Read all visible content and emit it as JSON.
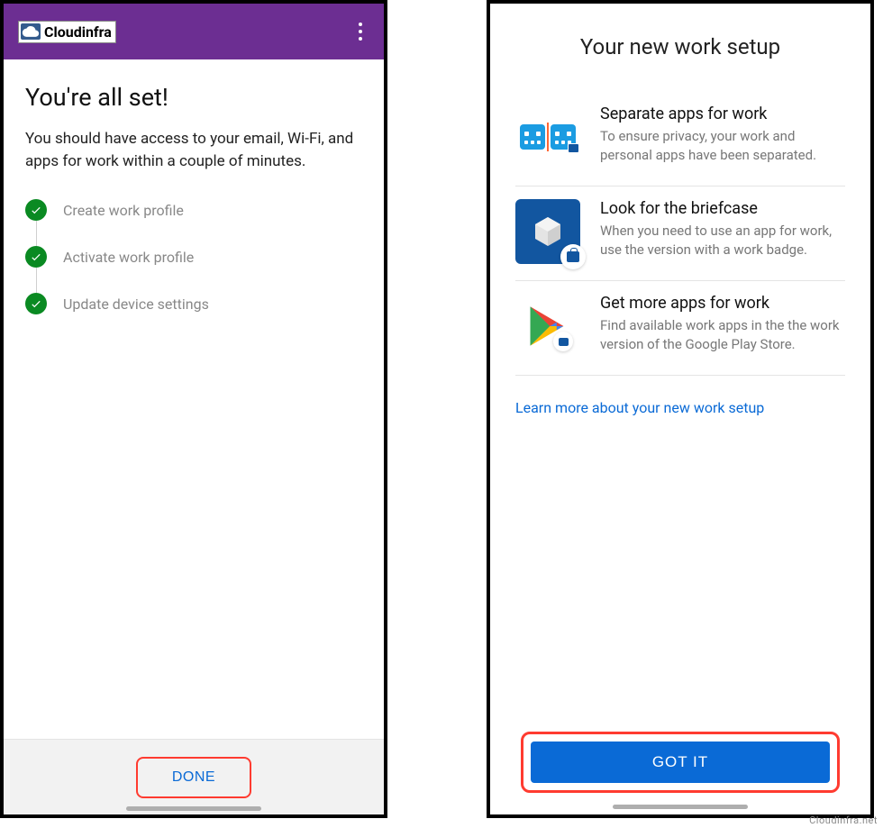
{
  "left": {
    "brand": "Cloudinfra",
    "title": "You're all set!",
    "subtitle": "You should have access to your email, Wi-Fi, and apps for work within a couple of minutes.",
    "steps": [
      "Create work profile",
      "Activate work profile",
      "Update device settings"
    ],
    "done_label": "DONE"
  },
  "right": {
    "title": "Your new work setup",
    "items": [
      {
        "heading": "Separate apps for work",
        "body": "To ensure privacy, your work and personal apps have been separated."
      },
      {
        "heading": "Look for the briefcase",
        "body": "When you need to use an app for work, use the version with a work badge."
      },
      {
        "heading": "Get more apps for work",
        "body": "Find available work apps in the the work version of the Google Play Store."
      }
    ],
    "learn_more": "Learn more about your new work setup",
    "gotit_label": "GOT IT"
  },
  "watermark": "Cloudinfra.net"
}
